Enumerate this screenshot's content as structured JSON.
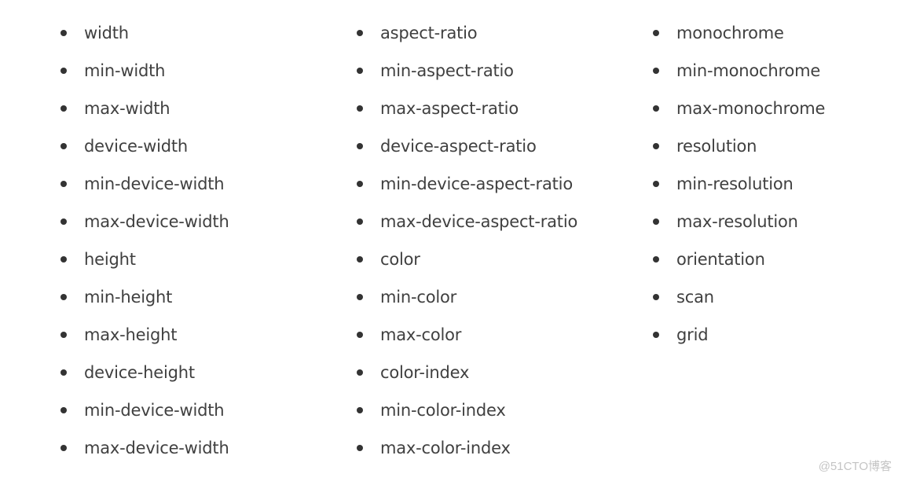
{
  "columns": [
    [
      "width",
      "min-width",
      "max-width",
      "device-width",
      "min-device-width",
      "max-device-width",
      "height",
      "min-height",
      "max-height",
      "device-height",
      "min-device-width",
      "max-device-width"
    ],
    [
      "aspect-ratio",
      "min-aspect-ratio",
      "max-aspect-ratio",
      "device-aspect-ratio",
      "min-device-aspect-ratio",
      "max-device-aspect-ratio",
      "color",
      "min-color",
      "max-color",
      "color-index",
      "min-color-index",
      "max-color-index"
    ],
    [
      "monochrome",
      "min-monochrome",
      "max-monochrome",
      "resolution",
      "min-resolution",
      "max-resolution",
      "orientation",
      "scan",
      "grid"
    ]
  ],
  "watermark": "@51CTO博客",
  "colors": {
    "text": "#404040",
    "bullet": "#333333",
    "watermark": "#c4c4c4"
  }
}
